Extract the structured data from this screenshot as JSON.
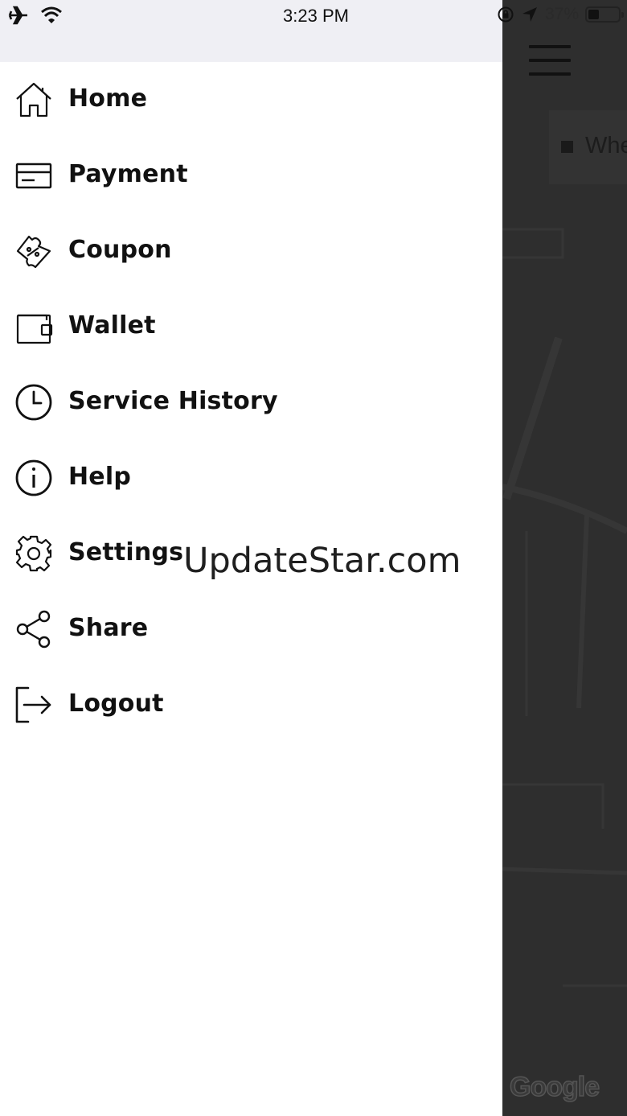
{
  "status_bar": {
    "time": "3:23 PM",
    "battery_percent": "37%",
    "battery_level": 0.37,
    "icons": [
      "airplane-icon",
      "wifi-icon",
      "orientation-lock-icon",
      "location-arrow-icon",
      "battery-icon"
    ]
  },
  "map": {
    "where_placeholder": "Whe",
    "attribution": "Google"
  },
  "menu": {
    "items": [
      {
        "label": "Home",
        "icon": "home-icon"
      },
      {
        "label": "Payment",
        "icon": "credit-card-icon"
      },
      {
        "label": "Coupon",
        "icon": "coupon-icon"
      },
      {
        "label": "Wallet",
        "icon": "wallet-icon"
      },
      {
        "label": "Service History",
        "icon": "clock-icon"
      },
      {
        "label": "Help",
        "icon": "info-icon"
      },
      {
        "label": "Settings",
        "icon": "gear-icon"
      },
      {
        "label": "Share",
        "icon": "share-icon"
      },
      {
        "label": "Logout",
        "icon": "logout-icon"
      }
    ]
  },
  "watermark": "UpdateStar.com"
}
